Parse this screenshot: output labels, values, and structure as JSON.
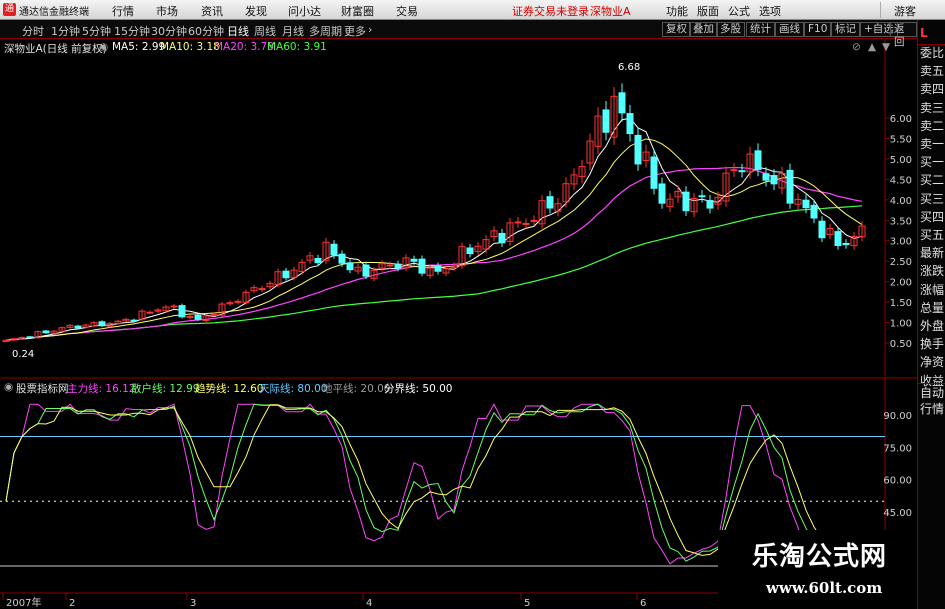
{
  "app": {
    "title": "通达信金融终端",
    "menu": [
      "行情",
      "市场",
      "资讯",
      "发现",
      "问小达",
      "财富圈",
      "交易"
    ],
    "notice": "证券交易未登录",
    "stock_tag": "深物业A",
    "right_menu": [
      "功能",
      "版面",
      "公式",
      "选项"
    ],
    "user": "游客"
  },
  "periods": {
    "items": [
      "分时",
      "1分钟",
      "5分钟",
      "15分钟",
      "30分钟",
      "60分钟",
      "日线",
      "周线",
      "月线",
      "多周期",
      "更多"
    ],
    "active": "日线"
  },
  "toolbar_buttons": [
    "复权",
    "叠加",
    "多股",
    "统计",
    "画线",
    "F10",
    "标记",
    "+自选",
    "返回"
  ],
  "main_info": {
    "name": "深物业A(日线 前复权)",
    "ma": [
      {
        "label": "MA5:",
        "value": "2.99",
        "color": "#ffffff"
      },
      {
        "label": "MA10:",
        "value": "3.18",
        "color": "#ffff66"
      },
      {
        "label": "MA20:",
        "value": "3.78",
        "color": "#ff44ff"
      },
      {
        "label": "MA60:",
        "value": "3.91",
        "color": "#44ff44"
      }
    ],
    "high_label": "6.68",
    "low_label": "0.24"
  },
  "sub_info": {
    "name": "股票指标网",
    "lines": [
      {
        "label": "主力线:",
        "value": "16.12",
        "color": "#ff44ff"
      },
      {
        "label": "散户线:",
        "value": "12.99",
        "color": "#66ff66"
      },
      {
        "label": "趋势线:",
        "value": "12.60",
        "color": "#ffff66"
      },
      {
        "label": "天际线:",
        "value": "80.00",
        "color": "#66ccff"
      },
      {
        "label": "地平线:",
        "value": "20.00",
        "color": "#999999"
      },
      {
        "label": "分界线:",
        "value": "50.00",
        "color": "#ffffff"
      }
    ]
  },
  "price_axis": [
    "6.00",
    "5.50",
    "5.00",
    "4.50",
    "4.00",
    "3.50",
    "3.00",
    "2.50",
    "2.00",
    "1.50",
    "1.00",
    "0.50"
  ],
  "ind_axis": [
    "90.00",
    "75.00",
    "60.00",
    "45.00"
  ],
  "date_axis": [
    "2007年",
    "2",
    "3",
    "4",
    "5",
    "6"
  ],
  "side_tabs": [
    "委比",
    "卖五",
    "卖四",
    "卖三",
    "卖二",
    "卖一",
    "买一",
    "买二",
    "买三",
    "买四",
    "买五",
    "最新",
    "涨跌",
    "涨幅",
    "总量",
    "外盘",
    "换手",
    "净资",
    "收益"
  ],
  "side_tabs_bottom": [
    "自动",
    "行情"
  ],
  "watermark": {
    "title": "乐淘公式网",
    "url": "www.60lt.com"
  },
  "colors": {
    "up": "#ff3232",
    "down": "#54ffff",
    "grid": "#8a0000",
    "bg": "#000000"
  }
}
